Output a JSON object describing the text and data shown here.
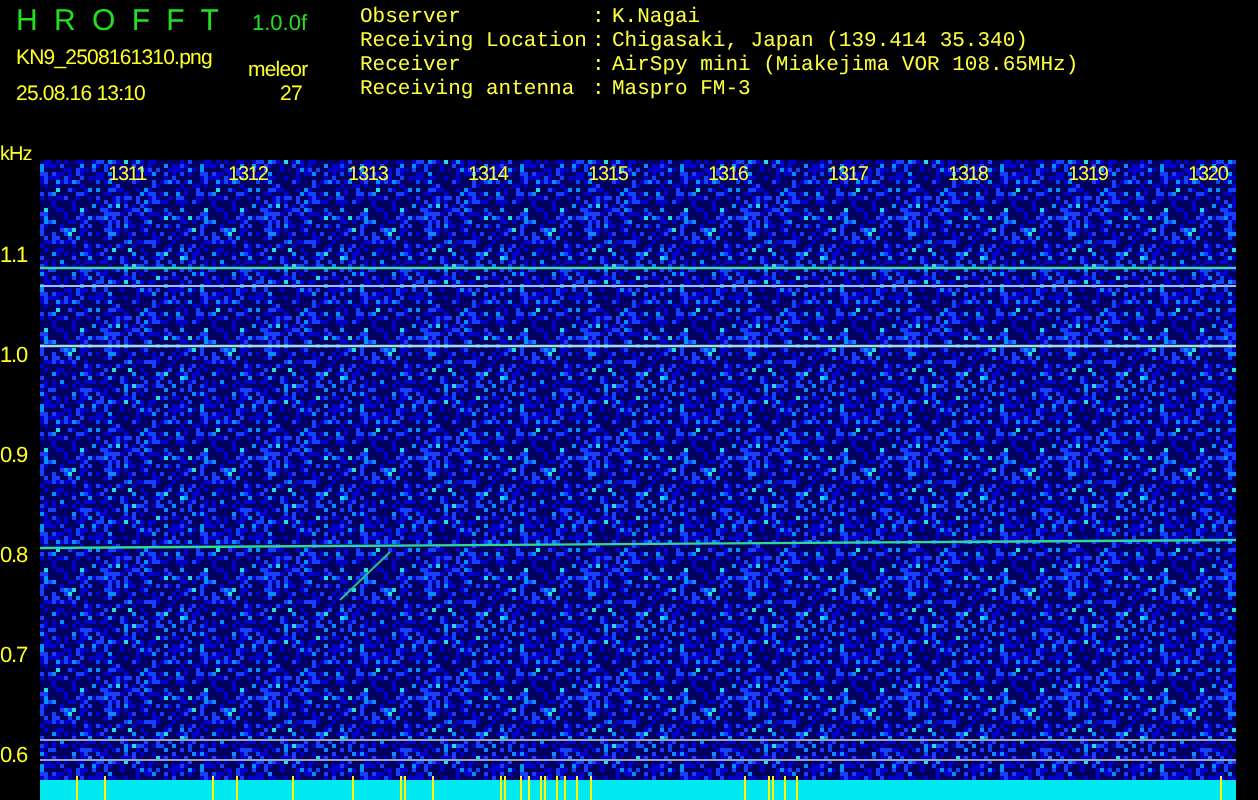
{
  "header": {
    "app_title": "H R O F F T",
    "version": "1.0.0f",
    "filename": "KN9_2508161310.png",
    "timestamp": "25.08.16 13:10",
    "counter_label": "meleor",
    "counter_value": "27"
  },
  "info": [
    {
      "label": "Observer",
      "separator": ":",
      "value": "K.Nagai"
    },
    {
      "label": "Receiving Location",
      "separator": ":",
      "value": "Chigasaki, Japan (139.414 35.340)"
    },
    {
      "label": "Receiver",
      "separator": ":",
      "value": "AirSpy mini (Miakejima VOR 108.65MHz)"
    },
    {
      "label": "Receiving antenna",
      "separator": ":",
      "value": "Maspro FM-3"
    }
  ],
  "spectrogram": {
    "y_unit": "kHz",
    "y_ticks": [
      "1.1",
      "1.0",
      "0.9",
      "0.8",
      "0.7",
      "0.6"
    ],
    "x_ticks": [
      "1311",
      "1312",
      "1313",
      "1314",
      "1315",
      "1316",
      "1317",
      "1318",
      "1319",
      "1320"
    ]
  }
}
